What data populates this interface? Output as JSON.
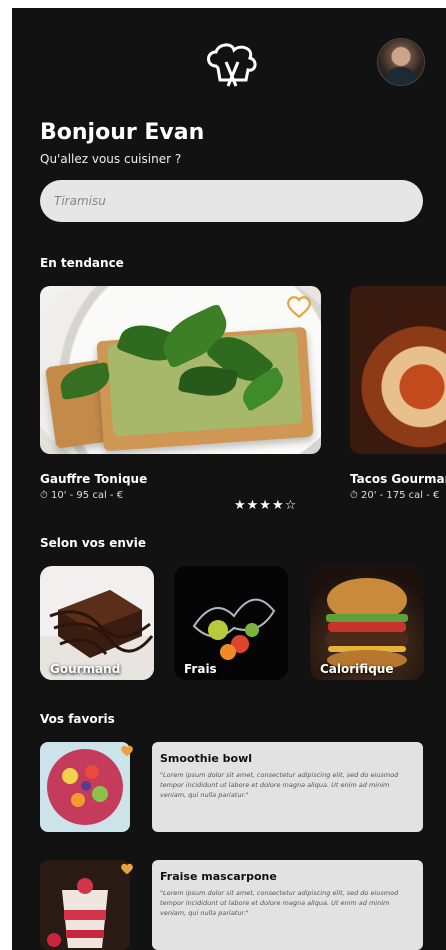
{
  "header": {
    "logo_icon": "chef-hat-utensils-icon",
    "avatar_icon": "user-avatar"
  },
  "greeting": {
    "title": "Bonjour Evan",
    "subtitle": "Qu'allez vous cuisiner ?"
  },
  "search": {
    "placeholder": "Tiramisu"
  },
  "trending": {
    "heading": "En tendance",
    "items": [
      {
        "title": "Gauffre Tonique",
        "meta": "⏱ 10' - 95 cal - €",
        "rating": "★★★★☆",
        "rating_value": 4,
        "rating_max": 5
      },
      {
        "title": "Tacos Gourmand",
        "meta": "⏱ 20' - 175 cal - €"
      }
    ]
  },
  "categories": {
    "heading": "Selon vos envie",
    "items": [
      {
        "label": "Gourmand"
      },
      {
        "label": "Frais"
      },
      {
        "label": "Calorifique"
      }
    ]
  },
  "favorites": {
    "heading": "Vos favoris",
    "items": [
      {
        "title": "Smoothie bowl",
        "description": "\"Lorem ipsum dolor sit amet, consectetur adipiscing elit, sed do eiusmod tempor incididunt ut labore et dolore magna aliqua. Ut enim ad minim veniam, qui nulla pariatur.\""
      },
      {
        "title": "Fraise mascarpone",
        "description": "\"Lorem ipsum dolor sit amet, consectetur adipiscing elit, sed do eiusmod tempor incididunt ut labore et dolore magna aliqua. Ut enim ad minim veniam, qui nulla pariatur.\""
      }
    ]
  },
  "colors": {
    "background": "#121212",
    "accent": "#e8a33d",
    "card": "#e2e2e2"
  }
}
